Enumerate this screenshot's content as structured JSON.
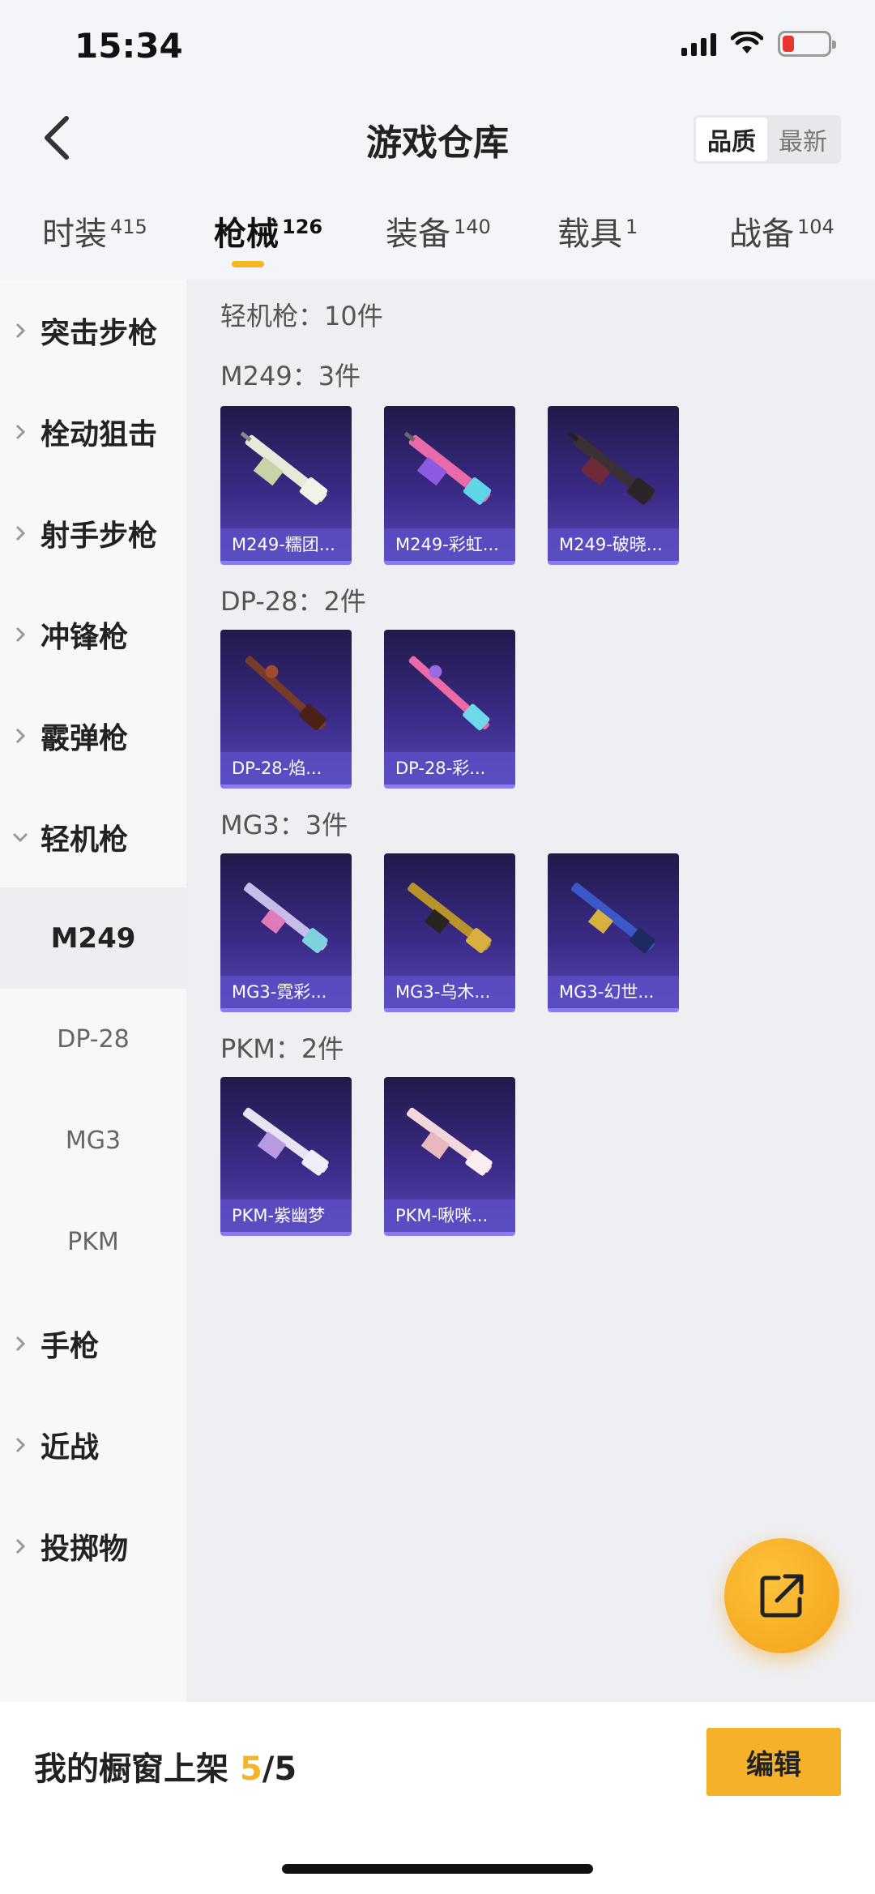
{
  "status_bar": {
    "time": "15:34"
  },
  "header": {
    "title": "游戏仓库",
    "sort_options": [
      "品质",
      "最新"
    ],
    "active_sort": "品质"
  },
  "tabs": [
    {
      "label": "时装",
      "count": "415"
    },
    {
      "label": "枪械",
      "count": "126"
    },
    {
      "label": "装备",
      "count": "140"
    },
    {
      "label": "载具",
      "count": "1"
    },
    {
      "label": "战备",
      "count": "104"
    }
  ],
  "sidebar": {
    "categories": [
      "突击步枪",
      "栓动狙击",
      "射手步枪",
      "冲锋枪",
      "霰弹枪",
      "轻机枪",
      "手枪",
      "近战",
      "投掷物"
    ],
    "expanded": "轻机枪",
    "subitems": [
      "M249",
      "DP-28",
      "MG3",
      "PKM"
    ],
    "active_sub": "M249"
  },
  "content": {
    "summary": "轻机枪：10件",
    "groups": [
      {
        "heading": "M249：3件",
        "items": [
          "M249-糯团...",
          "M249-彩虹...",
          "M249-破晓..."
        ]
      },
      {
        "heading": "DP-28：2件",
        "items": [
          "DP-28-焰...",
          "DP-28-彩..."
        ]
      },
      {
        "heading": "MG3：3件",
        "items": [
          "MG3-霓彩...",
          "MG3-乌木...",
          "MG3-幻世..."
        ]
      },
      {
        "heading": "PKM：2件",
        "items": [
          "PKM-紫幽梦",
          "PKM-啾咪..."
        ]
      }
    ]
  },
  "bottom_bar": {
    "label": "我的橱窗上架",
    "current": "5",
    "separator": "/",
    "total": "5",
    "edit_label": "编辑"
  },
  "icons": {
    "back": "back-arrow-icon",
    "share": "share-external-icon"
  },
  "colors": {
    "accent": "#f5b12a",
    "card_bg": "#3a2a86"
  }
}
